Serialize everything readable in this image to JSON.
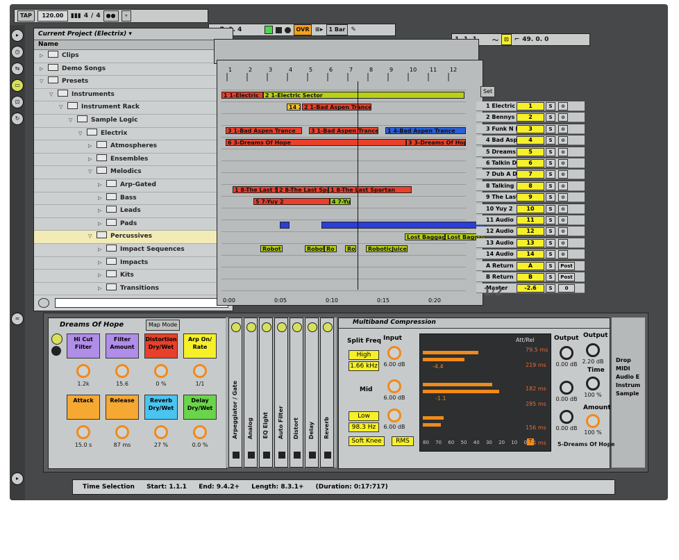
{
  "transport": {
    "tap": "TAP",
    "tempo": "120.00",
    "signature_num": "4",
    "signature_den": "4",
    "position": "7.  1.  4",
    "ovr": "OVR",
    "quant": "1 Bar",
    "right_pos": "1.  1.  1",
    "zoom": "49.  0.  0"
  },
  "browser": {
    "title": "Current Project (Electrix)",
    "column": "Name",
    "items": [
      {
        "label": "Clips",
        "indent": 0,
        "open": false
      },
      {
        "label": "Demo Songs",
        "indent": 0,
        "open": false
      },
      {
        "label": "Presets",
        "indent": 0,
        "open": true
      },
      {
        "label": "Instruments",
        "indent": 1,
        "open": true
      },
      {
        "label": "Instrument Rack",
        "indent": 2,
        "open": true
      },
      {
        "label": "Sample Logic",
        "indent": 3,
        "open": true
      },
      {
        "label": "Electrix",
        "indent": 4,
        "open": true
      },
      {
        "label": "Atmospheres",
        "indent": 5,
        "open": false
      },
      {
        "label": "Ensembles",
        "indent": 5,
        "open": false
      },
      {
        "label": "Melodics",
        "indent": 5,
        "open": true
      },
      {
        "label": "Arp-Gated",
        "indent": 6,
        "open": false
      },
      {
        "label": "Bass",
        "indent": 6,
        "open": false
      },
      {
        "label": "Leads",
        "indent": 6,
        "open": false
      },
      {
        "label": "Pads",
        "indent": 6,
        "open": false
      },
      {
        "label": "Percussives",
        "indent": 5,
        "open": true,
        "selected": true
      },
      {
        "label": "Impact Sequences",
        "indent": 6,
        "open": false
      },
      {
        "label": "Impacts",
        "indent": 6,
        "open": false
      },
      {
        "label": "Kits",
        "indent": 6,
        "open": false
      },
      {
        "label": "Transitions",
        "indent": 6,
        "open": false
      }
    ]
  },
  "ruler": [
    "1",
    "2",
    "3",
    "4",
    "5",
    "6",
    "7",
    "8",
    "9",
    "10",
    "11",
    "12"
  ],
  "timeline": [
    "0:00",
    "0:05",
    "0:10",
    "0:15",
    "0:20"
  ],
  "set_label": "Set",
  "page_indicator": "1/2",
  "clips": [
    {
      "label": "1 1-Electric",
      "row": 0,
      "start": 0,
      "len": 60,
      "color": "#e8402a"
    },
    {
      "label": "2 1-Electric Sector",
      "row": 0,
      "start": 60,
      "len": 290,
      "color": "#b8d016"
    },
    {
      "label": "14 2",
      "row": 1,
      "start": 94,
      "len": 20,
      "color": "#f5c328"
    },
    {
      "label": "2 1-Bad Aspen Trance",
      "row": 1,
      "start": 116,
      "len": 100,
      "color": "#e8402a"
    },
    {
      "label": "3 1-Bad Aspen Trance",
      "row": 3,
      "start": 6,
      "len": 110,
      "color": "#e8402a"
    },
    {
      "label": "3 1-Bad Aspen Trance",
      "row": 3,
      "start": 126,
      "len": 100,
      "color": "#e8402a"
    },
    {
      "label": "1 4-Bad Aspen Trance",
      "row": 3,
      "start": 236,
      "len": 116,
      "color": "#2a5ed8"
    },
    {
      "label": "6 3-Dreams Of Hope",
      "row": 4,
      "start": 6,
      "len": 260,
      "color": "#e8402a"
    },
    {
      "label": "3 3-Dreams Of Hope",
      "row": 4,
      "start": 266,
      "len": 86,
      "color": "#e8402a"
    },
    {
      "label": "1 8-The Last S",
      "row": 8,
      "start": 16,
      "len": 64,
      "color": "#e8402a"
    },
    {
      "label": "2 8-The Last Spar",
      "row": 8,
      "start": 80,
      "len": 74,
      "color": "#e8402a"
    },
    {
      "label": "1 8-The Last Spartan",
      "row": 8,
      "start": 154,
      "len": 120,
      "color": "#e8402a"
    },
    {
      "label": "5 7-Yuy 2",
      "row": 9,
      "start": 46,
      "len": 110,
      "color": "#e8402a"
    },
    {
      "label": "4 7-Yu",
      "row": 9,
      "start": 156,
      "len": 30,
      "color": "#98c81a"
    },
    {
      "label": "",
      "row": 11,
      "start": 84,
      "len": 14,
      "color": "#2a3ed8"
    },
    {
      "label": "",
      "row": 11,
      "start": 144,
      "len": 236,
      "color": "#2a3ed8"
    },
    {
      "label": "Lost Baggage",
      "row": 12,
      "start": 264,
      "len": 58,
      "color": "#b8d016"
    },
    {
      "label": "Lost Baggage",
      "row": 12,
      "start": 322,
      "len": 58,
      "color": "#b8d016"
    },
    {
      "label": "Robot",
      "row": 13,
      "start": 56,
      "len": 32,
      "color": "#b8d016"
    },
    {
      "label": "Robot",
      "row": 13,
      "start": 120,
      "len": 28,
      "color": "#b8d016"
    },
    {
      "label": "Ro",
      "row": 13,
      "start": 148,
      "len": 18,
      "color": "#b8d016"
    },
    {
      "label": "Ro",
      "row": 13,
      "start": 178,
      "len": 16,
      "color": "#b8d016"
    },
    {
      "label": "RoboticJuice",
      "row": 13,
      "start": 208,
      "len": 60,
      "color": "#b8d016"
    }
  ],
  "tracks": [
    {
      "name": "1 Electric Se",
      "num": "1"
    },
    {
      "name": "2 Bennys Le",
      "num": "2"
    },
    {
      "name": "3 Funk N Rid",
      "num": "3"
    },
    {
      "name": "4 Bad Aspen",
      "num": "4"
    },
    {
      "name": "5 Dreams Of",
      "num": "5"
    },
    {
      "name": "6 Talkin Dirt",
      "num": "6"
    },
    {
      "name": "7 Dub A Dub",
      "num": "7"
    },
    {
      "name": "8 Talking He",
      "num": "8"
    },
    {
      "name": "9 The Last S",
      "num": "9"
    },
    {
      "name": "10 Yuy 2",
      "num": "10"
    },
    {
      "name": "11 Audio",
      "num": "11"
    },
    {
      "name": "12 Audio",
      "num": "12"
    },
    {
      "name": "13 Audio",
      "num": "13"
    },
    {
      "name": "14 Audio",
      "num": "14"
    }
  ],
  "returns": [
    {
      "name": "A Return",
      "num": "A",
      "post": "Post"
    },
    {
      "name": "B Return",
      "num": "B",
      "post": "Post"
    },
    {
      "name": "Master",
      "num": "-2.6",
      "post": "0"
    }
  ],
  "rack": {
    "title": "Dreams Of Hope",
    "map_mode": "Map Mode",
    "macros": [
      {
        "label": "Hi Cut Filter",
        "value": "1.2k",
        "color": "#b08de8"
      },
      {
        "label": "Filter Amount",
        "value": "15.6",
        "color": "#b08de8"
      },
      {
        "label": "Distortion Dry/Wet",
        "value": "0 %",
        "color": "#e8402a"
      },
      {
        "label": "Arp On/ Rate",
        "value": "1/1",
        "color": "#f6f028"
      },
      {
        "label": "Attack",
        "value": "15.0 s",
        "color": "#f5a832"
      },
      {
        "label": "Release",
        "value": "87 ms",
        "color": "#f5a832"
      },
      {
        "label": "Reverb Dry/Wet",
        "value": "27 %",
        "color": "#4ac4f0"
      },
      {
        "label": "Delay Dry/Wet",
        "value": "0.0 %",
        "color": "#6ad44a"
      }
    ]
  },
  "chain": [
    "Arpeggiator / Gate",
    "Analog",
    "EQ Eight",
    "Auto Filter",
    "Distort",
    "Delay",
    "Reverb"
  ],
  "mbc": {
    "title": "Multiband Compression",
    "split_freq": "Split Freq",
    "input": "Input",
    "high": "High",
    "high_freq": "1.66 kHz",
    "mid": "Mid",
    "low": "Low",
    "low_freq": "98.3 Hz",
    "input_vals": [
      "6.00 dB",
      "6.00 dB",
      "6.00 dB"
    ],
    "soft_knee": "Soft Knee",
    "rms": "RMS",
    "att_rel": "Att/Rel",
    "times": [
      "79.5 ms",
      "219 ms",
      "182 ms",
      "285 ms",
      "156 ms",
      "364 ms"
    ],
    "gr": [
      "-4.4",
      "-1.1"
    ],
    "scale": [
      "80",
      "70",
      "60",
      "50",
      "40",
      "30",
      "20",
      "10",
      "0"
    ],
    "output": "Output",
    "out_vals": [
      "0.00 dB",
      "0.00 dB",
      "0.00 dB"
    ],
    "out2": "Output",
    "out2_val": "2.20 dB",
    "time": "Time",
    "time_val": "100 %",
    "amount": "Amount",
    "amount_val": "100 %"
  },
  "drop_hint": [
    "Drop MIDI",
    "Audio E",
    "Instrum",
    "Sample"
  ],
  "device_footer": "5-Dreams Of Hope",
  "status": {
    "label": "Time Selection",
    "start": "Start: 1.1.1",
    "end": "End: 9.4.2+",
    "length": "Length: 8.3.1+",
    "duration": "(Duration: 0:17:717)"
  }
}
